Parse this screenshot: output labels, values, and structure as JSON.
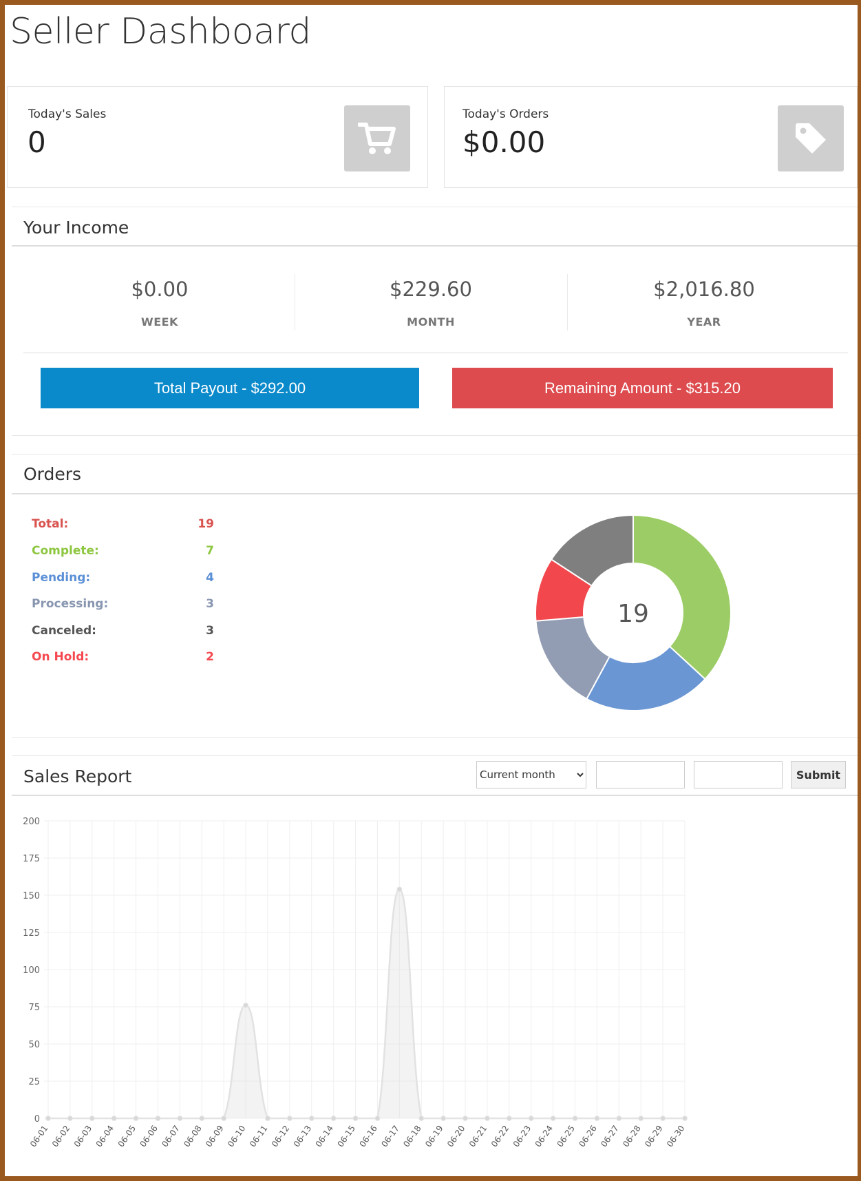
{
  "page": {
    "title": "Seller Dashboard"
  },
  "stats": {
    "sales": {
      "label": "Today's Sales",
      "value": "0",
      "icon": "cart-icon"
    },
    "orders": {
      "label": "Today's Orders",
      "value": "$0.00",
      "icon": "tag-icon"
    }
  },
  "income": {
    "title": "Your Income",
    "items": [
      {
        "amount": "$0.00",
        "label": "WEEK"
      },
      {
        "amount": "$229.60",
        "label": "MONTH"
      },
      {
        "amount": "$2,016.80",
        "label": "YEAR"
      }
    ],
    "payout_label": "Total Payout - $292.00",
    "remaining_label": "Remaining Amount - $315.20"
  },
  "orders": {
    "title": "Orders",
    "rows": [
      {
        "label": "Total:",
        "value": "19",
        "color": "#d9534f"
      },
      {
        "label": "Complete:",
        "value": "7",
        "color": "#8dc63f"
      },
      {
        "label": "Pending:",
        "value": "4",
        "color": "#5b8fd6"
      },
      {
        "label": "Processing:",
        "value": "3",
        "color": "#8896b0"
      },
      {
        "label": "Canceled:",
        "value": "3",
        "color": "#555555"
      },
      {
        "label": "On Hold:",
        "value": "2",
        "color": "#f5484f"
      }
    ],
    "donut_center": "19"
  },
  "sales_report": {
    "title": "Sales Report",
    "range_selected": "Current month",
    "submit_label": "Submit"
  },
  "chart_data": [
    {
      "type": "pie",
      "categories": [
        "Complete",
        "Pending",
        "Processing",
        "On Hold",
        "Canceled"
      ],
      "values": [
        7,
        4,
        3,
        2,
        3
      ],
      "colors": [
        "#9ccc65",
        "#6a96d4",
        "#929db3",
        "#f2474d",
        "#7f7f7f"
      ],
      "center_label": "19"
    },
    {
      "type": "area",
      "x": [
        "06-01",
        "06-02",
        "06-03",
        "06-04",
        "06-05",
        "06-06",
        "06-07",
        "06-08",
        "06-09",
        "06-10",
        "06-11",
        "06-12",
        "06-13",
        "06-14",
        "06-15",
        "06-16",
        "06-17",
        "06-18",
        "06-19",
        "06-20",
        "06-21",
        "06-22",
        "06-23",
        "06-24",
        "06-25",
        "06-26",
        "06-27",
        "06-28",
        "06-29",
        "06-30"
      ],
      "series": [
        {
          "values": [
            0,
            0,
            0,
            0,
            0,
            0,
            0,
            0,
            0,
            76,
            0,
            0,
            0,
            0,
            0,
            0,
            154,
            0,
            0,
            0,
            0,
            0,
            0,
            0,
            0,
            0,
            0,
            0,
            0,
            0
          ]
        }
      ],
      "ylim": [
        0,
        200
      ],
      "yticks": [
        0,
        25,
        50,
        75,
        100,
        125,
        150,
        175,
        200
      ],
      "grid": true,
      "color": "#e2e2e2"
    }
  ]
}
